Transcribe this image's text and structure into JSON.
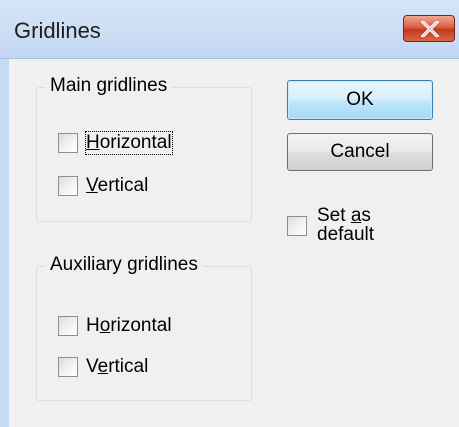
{
  "window": {
    "title": "Gridlines",
    "close_icon": "close-x-icon",
    "close_color": "#c94a2e",
    "titlebar_color": "#c5daf3"
  },
  "main_gridlines": {
    "label": "Main gridlines",
    "horizontal": {
      "label_pre": "",
      "mnemonic": "H",
      "label_post": "orizontal",
      "checked": false
    },
    "vertical": {
      "label_pre": "",
      "mnemonic": "V",
      "label_post": "ertical",
      "checked": false
    }
  },
  "auxiliary_gridlines": {
    "label": "Auxiliary gridlines",
    "horizontal": {
      "label_pre": "H",
      "mnemonic": "o",
      "label_post": "rizontal",
      "checked": false
    },
    "vertical": {
      "label_pre": "V",
      "mnemonic": "e",
      "label_post": "rtical",
      "checked": false
    }
  },
  "buttons": {
    "ok": "OK",
    "cancel": "Cancel"
  },
  "set_as_default": {
    "label_pre": "Set ",
    "mnemonic": "a",
    "label_post": "s default",
    "checked": false
  }
}
